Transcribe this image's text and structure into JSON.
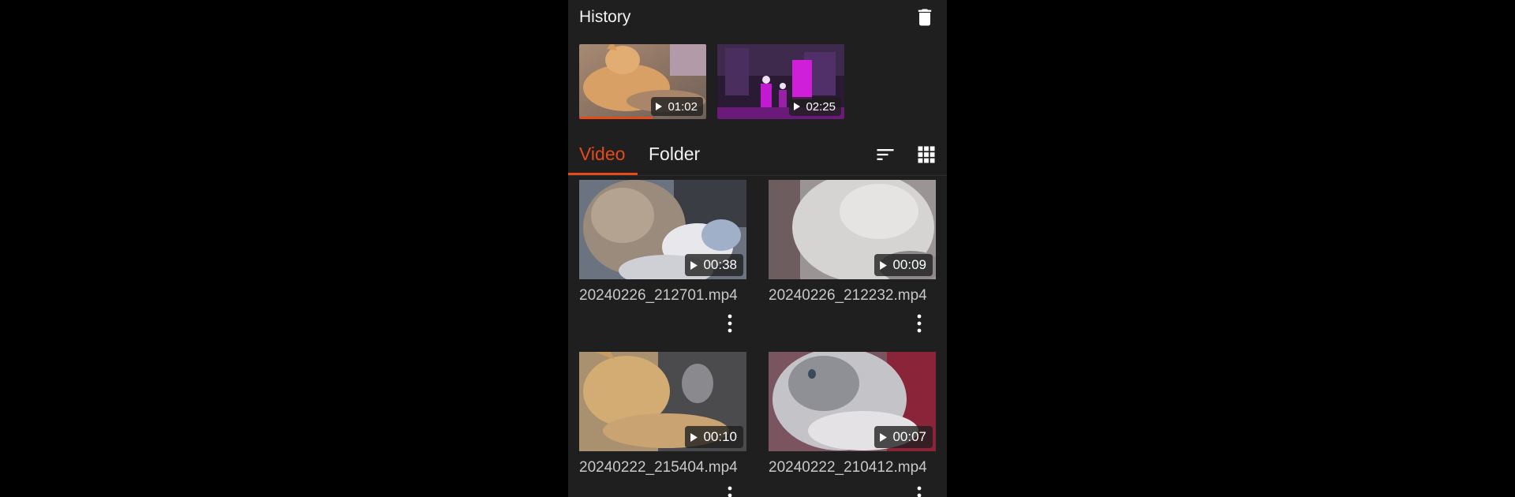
{
  "history": {
    "title": "History",
    "items": [
      {
        "duration": "01:02",
        "progress_fraction": 0.58
      },
      {
        "duration": "02:25",
        "progress_fraction": 0.0
      }
    ]
  },
  "tabs": {
    "video_label": "Video",
    "folder_label": "Folder",
    "active": "Video"
  },
  "videos": [
    {
      "name": "20240226_212701.mp4",
      "duration": "00:38"
    },
    {
      "name": "20240226_212232.mp4",
      "duration": "00:09"
    },
    {
      "name": "20240222_215404.mp4",
      "duration": "00:10"
    },
    {
      "name": "20240222_210412.mp4",
      "duration": "00:07"
    }
  ],
  "colors": {
    "accent": "#e64a19",
    "background": "#1f1f1f",
    "text_secondary": "#c8c8c8"
  },
  "icons": [
    "trash-icon",
    "play-icon",
    "sort-icon",
    "grid-view-icon",
    "more-vert-icon"
  ]
}
